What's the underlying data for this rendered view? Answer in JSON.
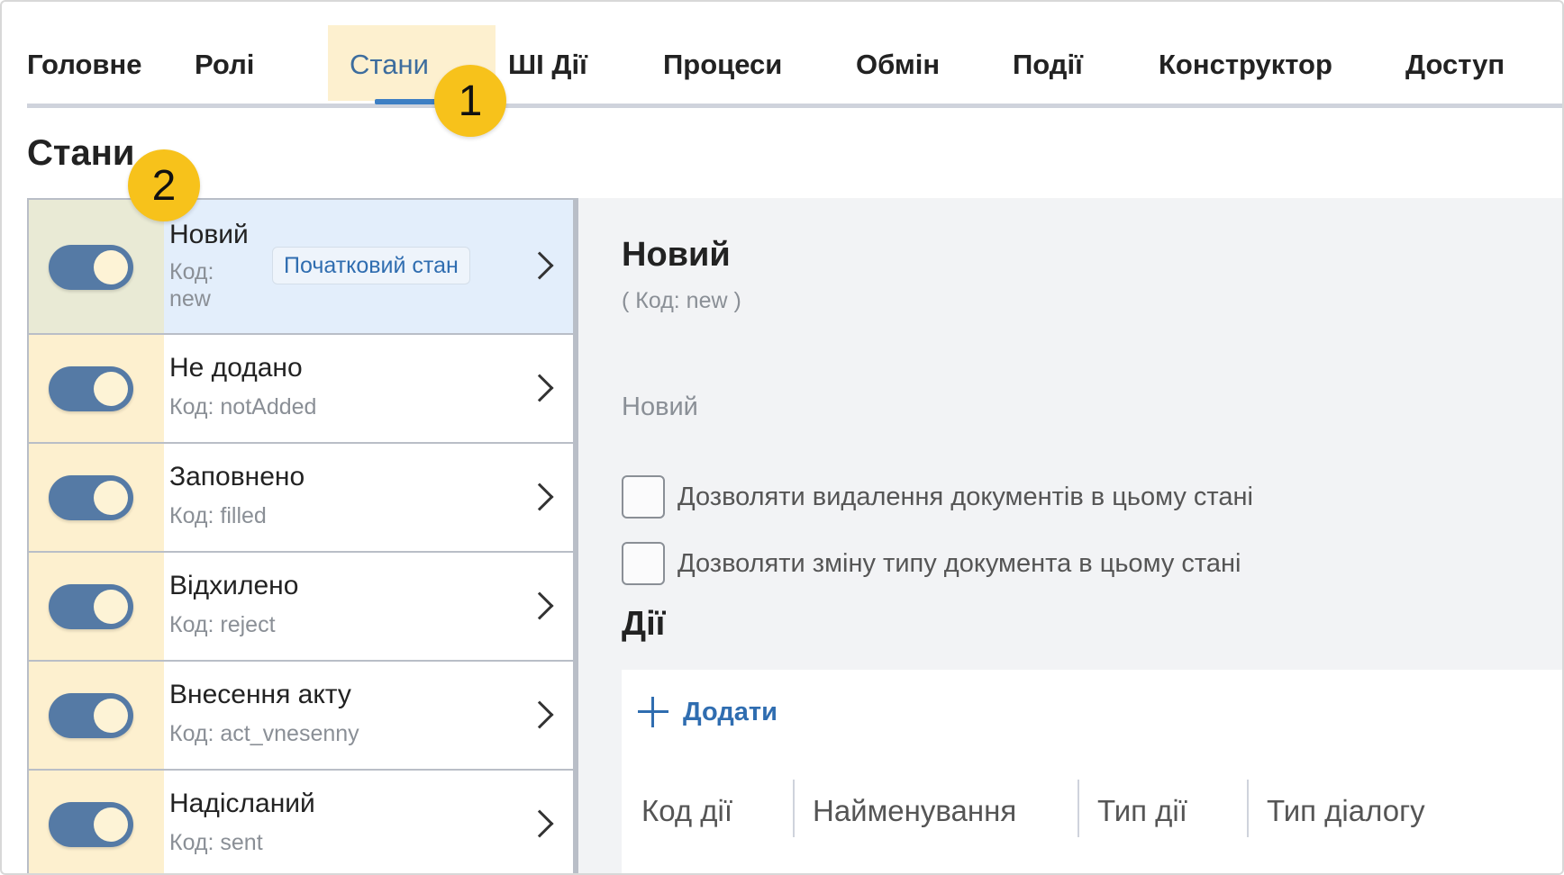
{
  "tabs": [
    {
      "label": "Головне"
    },
    {
      "label": "Ролі"
    },
    {
      "label": "Стани"
    },
    {
      "label": "ШІ Дії"
    },
    {
      "label": "Процеси"
    },
    {
      "label": "Обмін"
    },
    {
      "label": "Події"
    },
    {
      "label": "Конструктор"
    },
    {
      "label": "Доступ"
    }
  ],
  "active_tab": "Стани",
  "badges": {
    "one": "1",
    "two": "2"
  },
  "section_title": "Стани",
  "states": [
    {
      "name": "Новий",
      "code_prefix": "Код:",
      "code": "new",
      "tag": "Початковий стан",
      "enabled": true,
      "selected": true
    },
    {
      "name": "Не додано",
      "code_text": "Код: notAdded",
      "enabled": true
    },
    {
      "name": "Заповнено",
      "code_text": "Код: filled",
      "enabled": true
    },
    {
      "name": "Відхилено",
      "code_text": "Код: reject",
      "enabled": true
    },
    {
      "name": "Внесення акту",
      "code_text": "Код: act_vnesenny",
      "enabled": true
    },
    {
      "name": "Надісланий",
      "code_text": "Код: sent",
      "enabled": true
    }
  ],
  "detail": {
    "title": "Новий",
    "code_line": "( Код: new )",
    "name_value": "Новий",
    "checkbox_delete": "Дозволяти видалення документів в цьому стані",
    "checkbox_type_change": "Дозволяти зміну типу документа в цьому стані",
    "actions_title": "Дії",
    "add_label": "Додати",
    "columns": [
      "Код дії",
      "Найменування",
      "Тип дії",
      "Тип діалогу"
    ]
  },
  "colors": {
    "accent": "#2f6db0",
    "toggle_on": "#557aa5",
    "highlight": "#fdf0cf",
    "badge": "#f7c21b",
    "selected_row": "#e3eefb"
  }
}
